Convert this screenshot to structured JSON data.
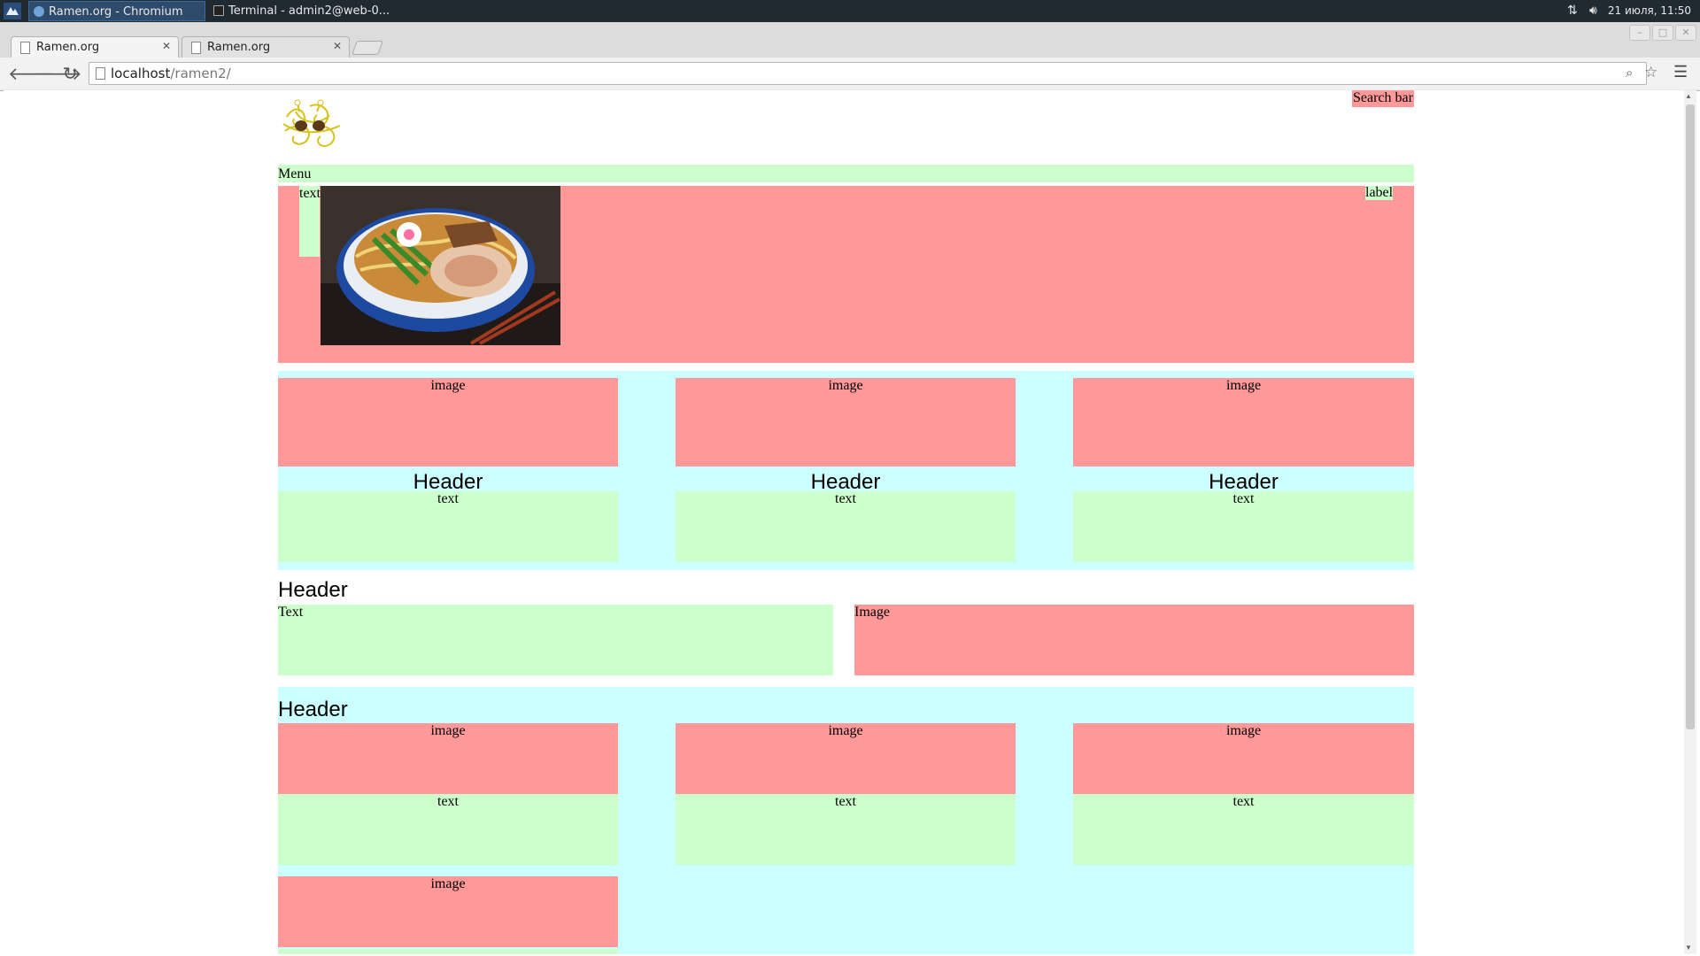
{
  "os": {
    "taskbar": {
      "tasks": [
        {
          "label": "Ramen.org - Chromium",
          "active": true
        },
        {
          "label": "Terminal - admin2@web-0..."
        }
      ],
      "clock": "21 июля, 11:50"
    }
  },
  "browser": {
    "tabs": [
      {
        "title": "Ramen.org"
      },
      {
        "title": "Ramen.org"
      }
    ],
    "address": {
      "host": "localhost",
      "path": "/ramen2/"
    }
  },
  "page": {
    "search_bar": "Search bar",
    "menu": "Menu",
    "hero": {
      "text": "text",
      "label": "label"
    },
    "features": [
      {
        "image": "image",
        "header": "Header",
        "text": "text"
      },
      {
        "image": "image",
        "header": "Header",
        "text": "text"
      },
      {
        "image": "image",
        "header": "Header",
        "text": "text"
      }
    ],
    "section2": {
      "header": "Header",
      "text": "Text",
      "image": "Image"
    },
    "section3": {
      "header": "Header",
      "cards": [
        {
          "image": "image",
          "text": "text"
        },
        {
          "image": "image",
          "text": "text"
        },
        {
          "image": "image",
          "text": "text"
        }
      ],
      "extra_image": "image"
    }
  },
  "colors": {
    "red": "#ff9999",
    "green": "#ccffcc",
    "cyan": "#ccffff"
  }
}
